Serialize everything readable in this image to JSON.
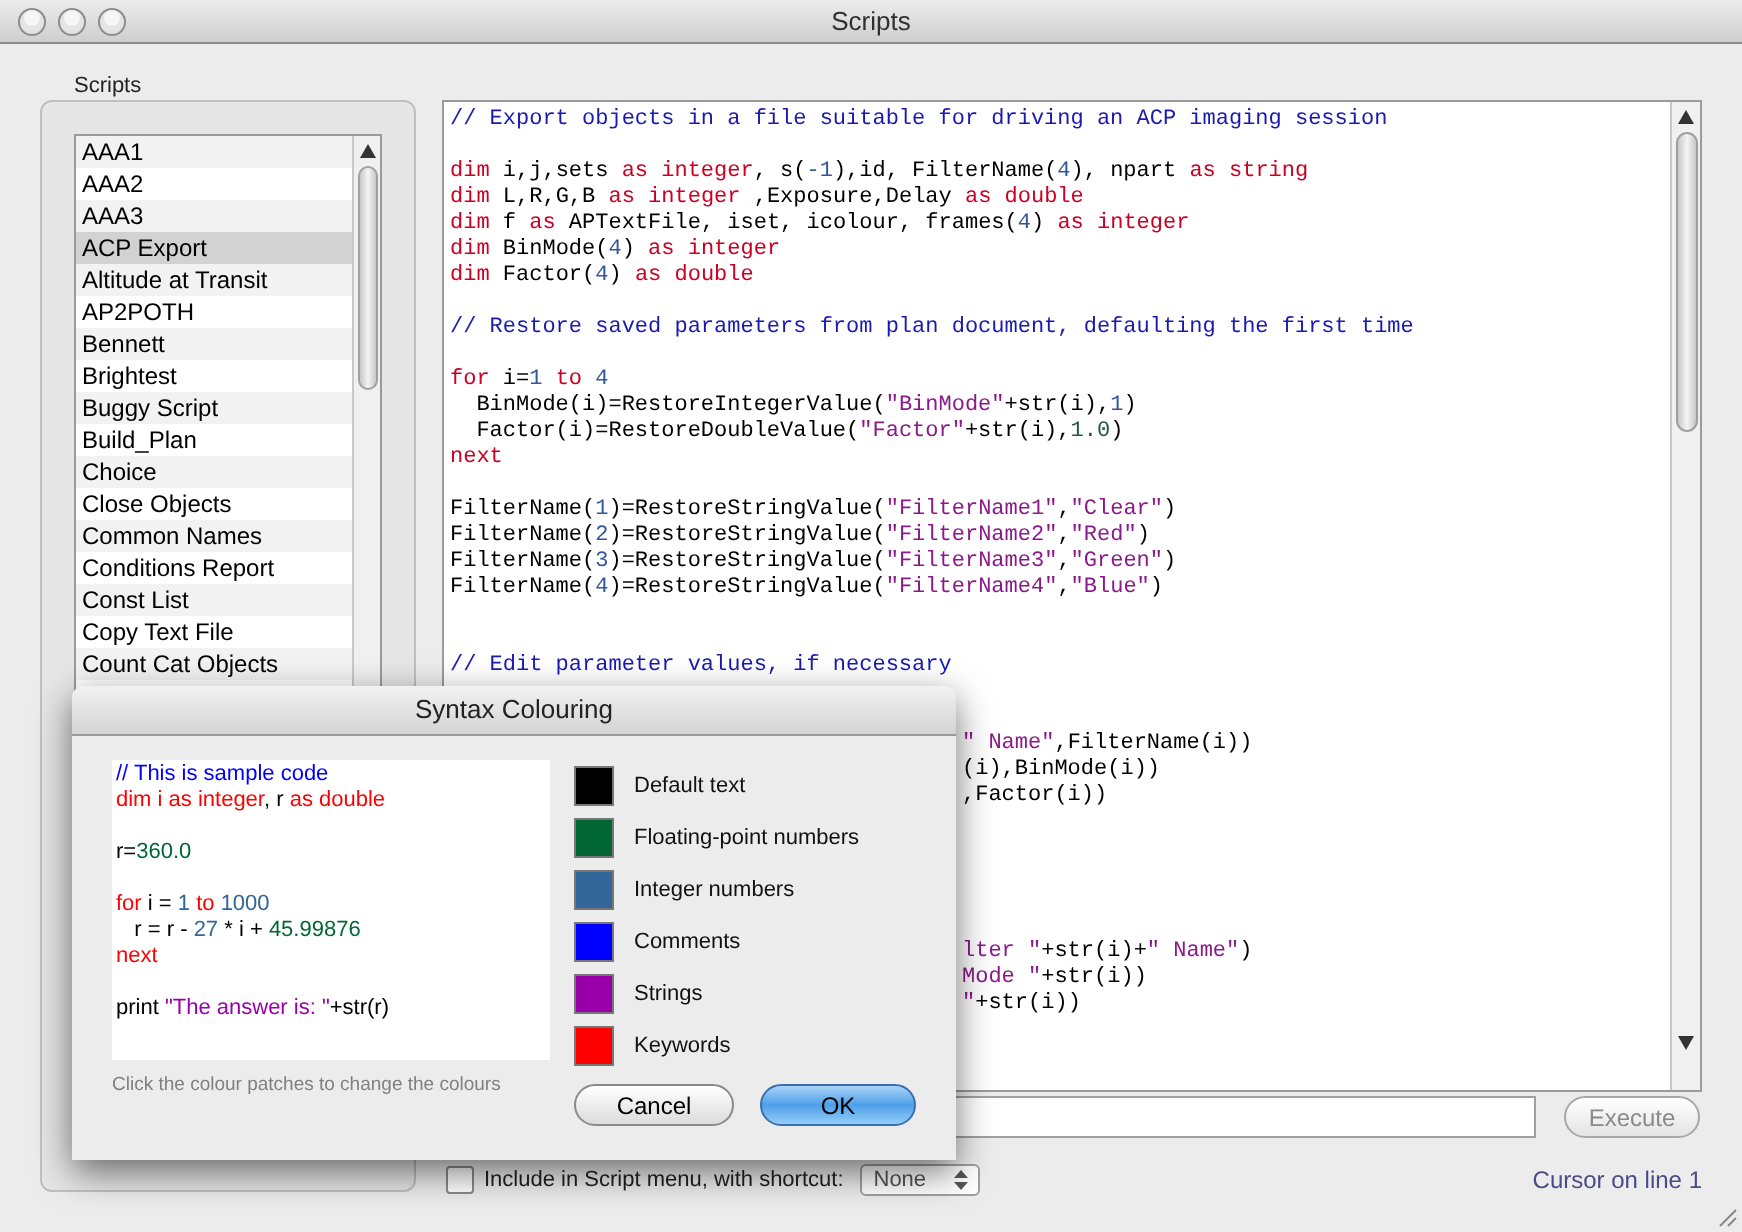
{
  "window": {
    "title": "Scripts"
  },
  "scripts_group": {
    "label": "Scripts",
    "items": [
      {
        "label": "AAA1",
        "selected": false
      },
      {
        "label": "AAA2",
        "selected": false
      },
      {
        "label": "AAA3",
        "selected": false
      },
      {
        "label": "ACP Export",
        "selected": true
      },
      {
        "label": "Altitude at Transit",
        "selected": false
      },
      {
        "label": "AP2POTH",
        "selected": false
      },
      {
        "label": "Bennett",
        "selected": false
      },
      {
        "label": "Brightest",
        "selected": false
      },
      {
        "label": "Buggy Script",
        "selected": false
      },
      {
        "label": "Build_Plan",
        "selected": false
      },
      {
        "label": "Choice",
        "selected": false
      },
      {
        "label": "Close Objects",
        "selected": false
      },
      {
        "label": "Common Names",
        "selected": false
      },
      {
        "label": "Conditions Report",
        "selected": false
      },
      {
        "label": "Const List",
        "selected": false
      },
      {
        "label": "Copy Text File",
        "selected": false
      },
      {
        "label": "Count Cat Objects",
        "selected": false
      }
    ]
  },
  "editor": {
    "lines": [
      {
        "kind": "code",
        "segments": [
          {
            "kind": "comment",
            "text": "// Export objects in a file suitable for driving an ACP imaging session"
          }
        ]
      },
      {
        "kind": "blank"
      },
      {
        "kind": "code",
        "segments": [
          {
            "kind": "keyword",
            "text": "dim"
          },
          {
            "kind": "default",
            "text": " i,j,sets "
          },
          {
            "kind": "keyword",
            "text": "as integer"
          },
          {
            "kind": "default",
            "text": ", s("
          },
          {
            "kind": "integer",
            "text": "-1"
          },
          {
            "kind": "default",
            "text": "),id, FilterName("
          },
          {
            "kind": "integer",
            "text": "4"
          },
          {
            "kind": "default",
            "text": "), npart "
          },
          {
            "kind": "keyword",
            "text": "as string"
          }
        ]
      },
      {
        "kind": "code",
        "segments": [
          {
            "kind": "keyword",
            "text": "dim"
          },
          {
            "kind": "default",
            "text": " L,R,G,B "
          },
          {
            "kind": "keyword",
            "text": "as integer"
          },
          {
            "kind": "default",
            "text": " ,Exposure,Delay "
          },
          {
            "kind": "keyword",
            "text": "as double"
          }
        ]
      },
      {
        "kind": "code",
        "segments": [
          {
            "kind": "keyword",
            "text": "dim"
          },
          {
            "kind": "default",
            "text": " f "
          },
          {
            "kind": "keyword",
            "text": "as"
          },
          {
            "kind": "default",
            "text": " APTextFile, iset, icolour, frames("
          },
          {
            "kind": "integer",
            "text": "4"
          },
          {
            "kind": "default",
            "text": ") "
          },
          {
            "kind": "keyword",
            "text": "as integer"
          }
        ]
      },
      {
        "kind": "code",
        "segments": [
          {
            "kind": "keyword",
            "text": "dim"
          },
          {
            "kind": "default",
            "text": " BinMode("
          },
          {
            "kind": "integer",
            "text": "4"
          },
          {
            "kind": "default",
            "text": ") "
          },
          {
            "kind": "keyword",
            "text": "as integer"
          }
        ]
      },
      {
        "kind": "code",
        "segments": [
          {
            "kind": "keyword",
            "text": "dim"
          },
          {
            "kind": "default",
            "text": " Factor("
          },
          {
            "kind": "integer",
            "text": "4"
          },
          {
            "kind": "default",
            "text": ") "
          },
          {
            "kind": "keyword",
            "text": "as double"
          }
        ]
      },
      {
        "kind": "blank"
      },
      {
        "kind": "code",
        "segments": [
          {
            "kind": "comment",
            "text": "// Restore saved parameters from plan document, defaulting the first time"
          }
        ]
      },
      {
        "kind": "blank"
      },
      {
        "kind": "code",
        "segments": [
          {
            "kind": "keyword",
            "text": "for"
          },
          {
            "kind": "default",
            "text": " i="
          },
          {
            "kind": "integer",
            "text": "1"
          },
          {
            "kind": "keyword",
            "text": " to "
          },
          {
            "kind": "integer",
            "text": "4"
          }
        ]
      },
      {
        "kind": "code",
        "segments": [
          {
            "kind": "default",
            "text": "  BinMode(i)=RestoreIntegerValue("
          },
          {
            "kind": "string",
            "text": "\"BinMode\""
          },
          {
            "kind": "default",
            "text": "+str(i),"
          },
          {
            "kind": "integer",
            "text": "1"
          },
          {
            "kind": "default",
            "text": ")"
          }
        ]
      },
      {
        "kind": "code",
        "segments": [
          {
            "kind": "default",
            "text": "  Factor(i)=RestoreDoubleValue("
          },
          {
            "kind": "string",
            "text": "\"Factor\""
          },
          {
            "kind": "default",
            "text": "+str(i),"
          },
          {
            "kind": "float",
            "text": "1.0"
          },
          {
            "kind": "default",
            "text": ")"
          }
        ]
      },
      {
        "kind": "code",
        "segments": [
          {
            "kind": "keyword",
            "text": "next"
          }
        ]
      },
      {
        "kind": "blank"
      },
      {
        "kind": "code",
        "segments": [
          {
            "kind": "default",
            "text": "FilterName("
          },
          {
            "kind": "integer",
            "text": "1"
          },
          {
            "kind": "default",
            "text": ")=RestoreStringValue("
          },
          {
            "kind": "string",
            "text": "\"FilterName1\""
          },
          {
            "kind": "default",
            "text": ","
          },
          {
            "kind": "string",
            "text": "\"Clear\""
          },
          {
            "kind": "default",
            "text": ")"
          }
        ]
      },
      {
        "kind": "code",
        "segments": [
          {
            "kind": "default",
            "text": "FilterName("
          },
          {
            "kind": "integer",
            "text": "2"
          },
          {
            "kind": "default",
            "text": ")=RestoreStringValue("
          },
          {
            "kind": "string",
            "text": "\"FilterName2\""
          },
          {
            "kind": "default",
            "text": ","
          },
          {
            "kind": "string",
            "text": "\"Red\""
          },
          {
            "kind": "default",
            "text": ")"
          }
        ]
      },
      {
        "kind": "code",
        "segments": [
          {
            "kind": "default",
            "text": "FilterName("
          },
          {
            "kind": "integer",
            "text": "3"
          },
          {
            "kind": "default",
            "text": ")=RestoreStringValue("
          },
          {
            "kind": "string",
            "text": "\"FilterName3\""
          },
          {
            "kind": "default",
            "text": ","
          },
          {
            "kind": "string",
            "text": "\"Green\""
          },
          {
            "kind": "default",
            "text": ")"
          }
        ]
      },
      {
        "kind": "code",
        "segments": [
          {
            "kind": "default",
            "text": "FilterName("
          },
          {
            "kind": "integer",
            "text": "4"
          },
          {
            "kind": "default",
            "text": ")=RestoreStringValue("
          },
          {
            "kind": "string",
            "text": "\"FilterName4\""
          },
          {
            "kind": "default",
            "text": ","
          },
          {
            "kind": "string",
            "text": "\"Blue\""
          },
          {
            "kind": "default",
            "text": ")"
          }
        ]
      },
      {
        "kind": "blank"
      },
      {
        "kind": "blank"
      },
      {
        "kind": "code",
        "segments": [
          {
            "kind": "comment",
            "text": "// Edit parameter values, if necessary"
          }
        ]
      },
      {
        "kind": "blank"
      },
      {
        "kind": "blank"
      },
      {
        "kind": "partial",
        "segments": [
          {
            "kind": "string",
            "text": "\" Name\""
          },
          {
            "kind": "default",
            "text": ",FilterName(i))"
          }
        ]
      },
      {
        "kind": "partial",
        "segments": [
          {
            "kind": "default",
            "text": "(i),BinMode(i))"
          }
        ]
      },
      {
        "kind": "partial",
        "segments": [
          {
            "kind": "default",
            "text": ",Factor(i))"
          }
        ]
      },
      {
        "kind": "blank"
      },
      {
        "kind": "blank"
      },
      {
        "kind": "blank"
      },
      {
        "kind": "blank"
      },
      {
        "kind": "blank"
      },
      {
        "kind": "partial",
        "segments": [
          {
            "kind": "string",
            "text": "lter \""
          },
          {
            "kind": "default",
            "text": "+str(i)+"
          },
          {
            "kind": "string",
            "text": "\" Name\""
          },
          {
            "kind": "default",
            "text": ")"
          }
        ]
      },
      {
        "kind": "partial",
        "segments": [
          {
            "kind": "string",
            "text": "Mode \""
          },
          {
            "kind": "default",
            "text": "+str(i))"
          }
        ]
      },
      {
        "kind": "partial",
        "segments": [
          {
            "kind": "string",
            "text": "\""
          },
          {
            "kind": "default",
            "text": "+str(i))"
          }
        ]
      }
    ]
  },
  "execute_button": {
    "label": "Execute"
  },
  "include_option": {
    "label": "Include in Script menu, with shortcut:",
    "checked": false
  },
  "shortcut_select": {
    "value": "None"
  },
  "status": "Cursor on line 1",
  "dialog": {
    "title": "Syntax Colouring",
    "sample_lines": [
      {
        "kind": "code",
        "segments": [
          {
            "kind": "comment",
            "text": "// This is sample code"
          }
        ]
      },
      {
        "kind": "code",
        "segments": [
          {
            "kind": "keyword",
            "text": "dim i as integer"
          },
          {
            "kind": "default",
            "text": ", r "
          },
          {
            "kind": "keyword",
            "text": "as double"
          }
        ]
      },
      {
        "kind": "blank"
      },
      {
        "kind": "code",
        "segments": [
          {
            "kind": "default",
            "text": "r="
          },
          {
            "kind": "float",
            "text": "360.0"
          }
        ]
      },
      {
        "kind": "blank"
      },
      {
        "kind": "code",
        "segments": [
          {
            "kind": "keyword",
            "text": "for"
          },
          {
            "kind": "default",
            "text": " i = "
          },
          {
            "kind": "integer",
            "text": "1"
          },
          {
            "kind": "keyword",
            "text": " to "
          },
          {
            "kind": "integer",
            "text": "1000"
          }
        ]
      },
      {
        "kind": "code",
        "segments": [
          {
            "kind": "default",
            "text": "   r = r - "
          },
          {
            "kind": "integer",
            "text": "27"
          },
          {
            "kind": "default",
            "text": " * i + "
          },
          {
            "kind": "float",
            "text": "45.99876"
          }
        ]
      },
      {
        "kind": "code",
        "segments": [
          {
            "kind": "keyword",
            "text": "next"
          }
        ]
      },
      {
        "kind": "blank"
      },
      {
        "kind": "code",
        "segments": [
          {
            "kind": "default",
            "text": "print "
          },
          {
            "kind": "string",
            "text": "\"The answer is: \""
          },
          {
            "kind": "default",
            "text": "+str(r)"
          }
        ]
      }
    ],
    "hint": "Click the colour patches to change the colours",
    "colours": [
      {
        "kind": "default",
        "label": "Default text",
        "color": "#000000"
      },
      {
        "kind": "float",
        "label": "Floating-point numbers",
        "color": "#006633"
      },
      {
        "kind": "integer",
        "label": "Integer numbers",
        "color": "#336699"
      },
      {
        "kind": "comment",
        "label": "Comments",
        "color": "#0000ff"
      },
      {
        "kind": "string",
        "label": "Strings",
        "color": "#9900aa"
      },
      {
        "kind": "keyword",
        "label": "Keywords",
        "color": "#ff0000"
      }
    ],
    "buttons": [
      {
        "kind": "cancel",
        "label": "Cancel"
      },
      {
        "kind": "default",
        "label": "OK"
      }
    ]
  }
}
